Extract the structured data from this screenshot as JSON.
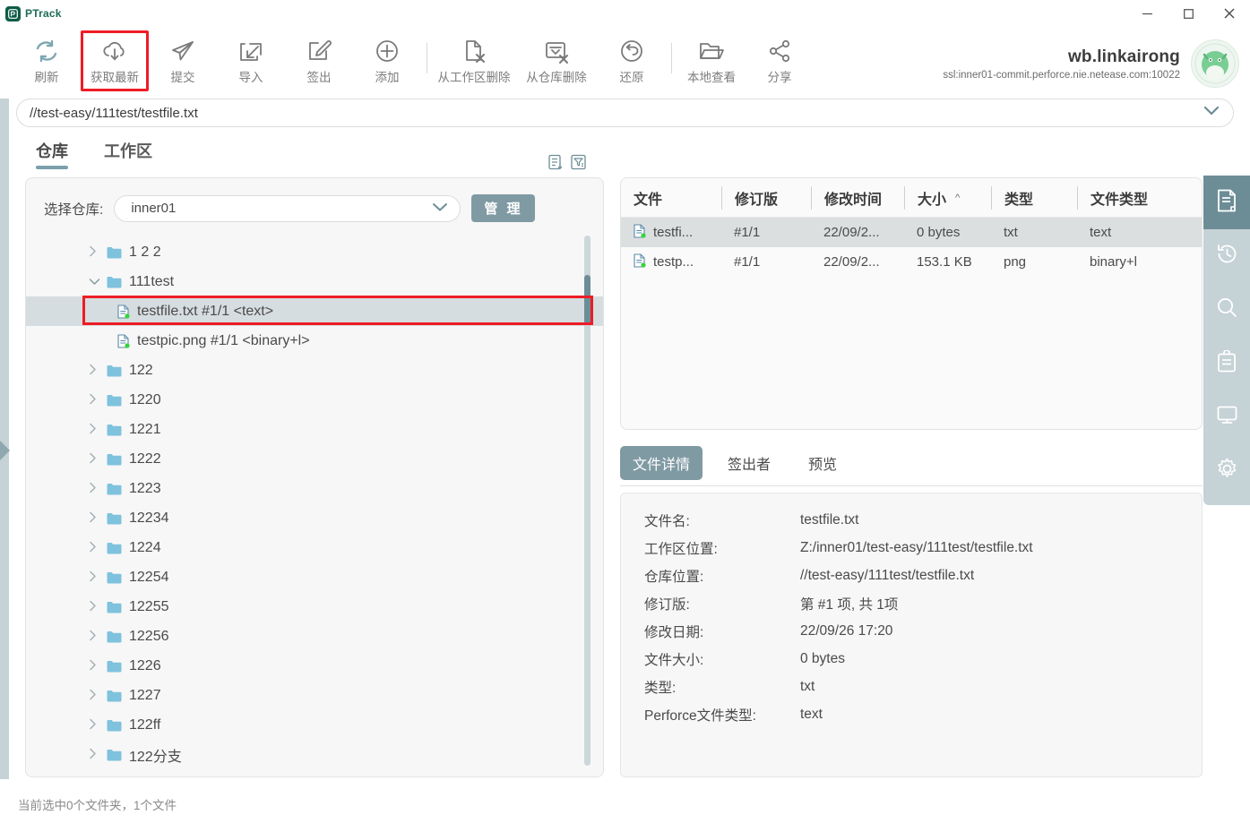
{
  "window": {
    "app_title": "PTrack",
    "minimize_label": "minimize",
    "maximize_label": "maximize",
    "close_label": "close"
  },
  "toolbar": {
    "items": [
      {
        "label": "刷新",
        "icon": "refresh-icon"
      },
      {
        "label": "获取最新",
        "icon": "cloud-download-icon"
      },
      {
        "label": "提交",
        "icon": "submit-paperplane-icon"
      },
      {
        "label": "导入",
        "icon": "import-icon"
      },
      {
        "label": "签出",
        "icon": "checkout-edit-icon"
      },
      {
        "label": "添加",
        "icon": "add-plus-icon"
      },
      {
        "label": "从工作区删除",
        "icon": "delete-from-workspace-icon"
      },
      {
        "label": "从仓库删除",
        "icon": "delete-from-depot-icon"
      },
      {
        "label": "还原",
        "icon": "revert-undo-icon"
      },
      {
        "label": "本地查看",
        "icon": "open-folder-icon"
      },
      {
        "label": "分享",
        "icon": "share-icon"
      }
    ]
  },
  "account": {
    "name": "wb.linkairong",
    "server": "ssl:inner01-commit.perforce.nie.netease.com:10022",
    "avatar_icon": "avatar-icon"
  },
  "pathbar": {
    "value": "//test-easy/111test/testfile.txt",
    "chevron_icon": "chevron-down-icon"
  },
  "tabs": {
    "items": [
      {
        "label": "仓库",
        "active": true
      },
      {
        "label": "工作区",
        "active": false
      }
    ],
    "icons": [
      {
        "name": "sort-list-icon"
      },
      {
        "name": "filter-icon"
      }
    ]
  },
  "repo": {
    "label": "选择仓库:",
    "selected": "inner01",
    "placeholder": "inner01",
    "manage_label": "管 理",
    "chevron_icon": "chevron-down-icon"
  },
  "tree": {
    "nodes": [
      {
        "label": "1 2 2",
        "type": "folder",
        "expanded": false,
        "depth": 0
      },
      {
        "label": "111test",
        "type": "folder",
        "expanded": true,
        "depth": 0
      },
      {
        "label": "testfile.txt  #1/1 <text>",
        "type": "file",
        "depth": 1,
        "selected": true
      },
      {
        "label": "testpic.png  #1/1 <binary+l>",
        "type": "file",
        "depth": 1,
        "selected": false
      },
      {
        "label": "122",
        "type": "folder",
        "expanded": false,
        "depth": 0
      },
      {
        "label": "1220",
        "type": "folder",
        "expanded": false,
        "depth": 0
      },
      {
        "label": "1221",
        "type": "folder",
        "expanded": false,
        "depth": 0
      },
      {
        "label": "1222",
        "type": "folder",
        "expanded": false,
        "depth": 0
      },
      {
        "label": "1223",
        "type": "folder",
        "expanded": false,
        "depth": 0
      },
      {
        "label": "12234",
        "type": "folder",
        "expanded": false,
        "depth": 0
      },
      {
        "label": "1224",
        "type": "folder",
        "expanded": false,
        "depth": 0
      },
      {
        "label": "12254",
        "type": "folder",
        "expanded": false,
        "depth": 0
      },
      {
        "label": "12255",
        "type": "folder",
        "expanded": false,
        "depth": 0
      },
      {
        "label": "12256",
        "type": "folder",
        "expanded": false,
        "depth": 0
      },
      {
        "label": "1226",
        "type": "folder",
        "expanded": false,
        "depth": 0
      },
      {
        "label": "1227",
        "type": "folder",
        "expanded": false,
        "depth": 0
      },
      {
        "label": "122ff",
        "type": "folder",
        "expanded": false,
        "depth": 0
      },
      {
        "label": "122分支",
        "type": "folder",
        "expanded": false,
        "depth": 0
      }
    ]
  },
  "file_table": {
    "columns": [
      {
        "label": "文件",
        "sorted": false
      },
      {
        "label": "修订版",
        "sorted": false
      },
      {
        "label": "修改时间",
        "sorted": false
      },
      {
        "label": "大小",
        "sorted": true,
        "sort_caret": "^"
      },
      {
        "label": "类型",
        "sorted": false
      },
      {
        "label": "文件类型",
        "sorted": false
      }
    ],
    "rows": [
      {
        "file": "testfi...",
        "rev": "#1/1",
        "time": "22/09/2...",
        "size": "0 bytes",
        "type": "txt",
        "ftype": "text",
        "selected": true
      },
      {
        "file": "testp...",
        "rev": "#1/1",
        "time": "22/09/2...",
        "size": "153.1 KB",
        "type": "png",
        "ftype": "binary+l",
        "selected": false
      }
    ]
  },
  "detail": {
    "tabs": [
      {
        "label": "文件详情",
        "active": true
      },
      {
        "label": "签出者",
        "active": false
      },
      {
        "label": "预览",
        "active": false
      }
    ],
    "rows": [
      {
        "key": "文件名:",
        "value": "testfile.txt"
      },
      {
        "key": "工作区位置:",
        "value": "Z:/inner01/test-easy/111test/testfile.txt"
      },
      {
        "key": "仓库位置:",
        "value": "//test-easy/111test/testfile.txt"
      },
      {
        "key": "修订版:",
        "value": "第 #1 项, 共 1项"
      },
      {
        "key": "修改日期:",
        "value": "22/09/26 17:20"
      },
      {
        "key": "文件大小:",
        "value": "0 bytes"
      },
      {
        "key": "类型:",
        "value": "txt"
      },
      {
        "key": "Perforce文件类型:",
        "value": "text"
      }
    ]
  },
  "rail": {
    "items": [
      {
        "icon": "document-icon",
        "active": true
      },
      {
        "icon": "history-icon",
        "active": false
      },
      {
        "icon": "search-icon",
        "active": false
      },
      {
        "icon": "clipboard-icon",
        "active": false
      },
      {
        "icon": "monitor-icon",
        "active": false
      },
      {
        "icon": "gear-icon",
        "active": false
      }
    ]
  },
  "status": {
    "text": "当前选中0个文件夹，1个文件"
  },
  "colors": {
    "accent": "#6d8d96",
    "accent_light": "#7f9aa3",
    "rail_bg": "#c5d2d6",
    "highlight_red": "#ee1c25",
    "logo_green": "#0f5c47",
    "folder_blue": "#7fc2dd"
  }
}
